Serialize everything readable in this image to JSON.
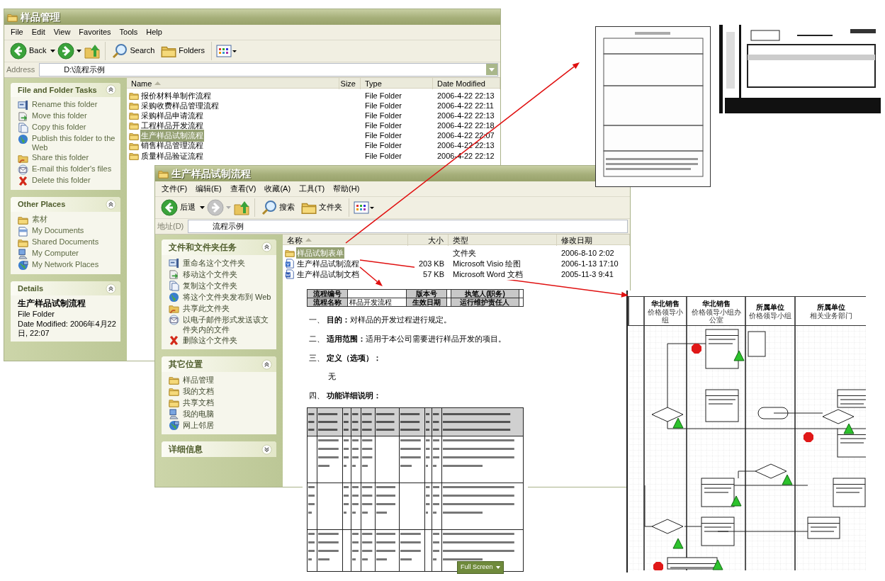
{
  "windows": [
    {
      "title": "样品管理",
      "menu": [
        "File",
        "Edit",
        "View",
        "Favorites",
        "Tools",
        "Help"
      ],
      "back_label": "Back",
      "forward_enabled": true,
      "search_label": "Search",
      "folders_label": "Folders",
      "address_label": "Address",
      "address": "D:\\流程示例",
      "address_dropdown": true,
      "columns": [
        "Name",
        "Size",
        "Type",
        "Date Modified"
      ],
      "rows": [
        {
          "kind": "folder",
          "name": "报价材料单制作流程",
          "type": "File Folder",
          "date": "2006-4-22 22:13",
          "selected": false
        },
        {
          "kind": "folder",
          "name": "采购收费样品管理流程",
          "type": "File Folder",
          "date": "2006-4-22 22:11",
          "selected": false
        },
        {
          "kind": "folder",
          "name": "采购样品申请流程",
          "type": "File Folder",
          "date": "2006-4-22 22:13",
          "selected": false
        },
        {
          "kind": "folder",
          "name": "工程样品开发流程",
          "type": "File Folder",
          "date": "2006-4-22 22:18",
          "selected": false
        },
        {
          "kind": "folder",
          "name": "生产样品试制流程",
          "type": "File Folder",
          "date": "2006-4-22 22:07",
          "selected": true
        },
        {
          "kind": "folder",
          "name": "销售样品管理流程",
          "type": "File Folder",
          "date": "2006-4-22 22:13",
          "selected": false
        },
        {
          "kind": "folder",
          "name": "质量样品验证流程",
          "type": "File Folder",
          "date": "2006-4-22 22:12",
          "selected": false
        }
      ],
      "panels": [
        {
          "kind": "tasks",
          "title": "File and Folder Tasks",
          "expanded": true,
          "items": [
            {
              "kind": "rename",
              "label": "Rename this folder"
            },
            {
              "kind": "move",
              "label": "Move this folder"
            },
            {
              "kind": "copy",
              "label": "Copy this folder"
            },
            {
              "kind": "publish",
              "label": "Publish this folder to the Web"
            },
            {
              "kind": "share",
              "label": "Share this folder"
            },
            {
              "kind": "email",
              "label": "E-mail this folder's files"
            },
            {
              "kind": "delete",
              "label": "Delete this folder"
            }
          ]
        },
        {
          "kind": "tasks",
          "title": "Other Places",
          "expanded": true,
          "items": [
            {
              "kind": "folder",
              "label": "素材"
            },
            {
              "kind": "documents",
              "label": "My Documents"
            },
            {
              "kind": "folder",
              "label": "Shared Documents"
            },
            {
              "kind": "computer",
              "label": "My Computer"
            },
            {
              "kind": "network",
              "label": "My Network Places"
            }
          ]
        },
        {
          "kind": "details",
          "title": "Details",
          "expanded": true,
          "name": "生产样品试制流程",
          "type": "File Folder",
          "modified": "Date Modified: 2006年4月22日, 22:07"
        }
      ]
    },
    {
      "title": "生产样品试制流程",
      "menu": [
        "文件(F)",
        "编辑(E)",
        "查看(V)",
        "收藏(A)",
        "工具(T)",
        "帮助(H)"
      ],
      "back_label": "后退",
      "forward_enabled": false,
      "search_label": "搜索",
      "folders_label": "文件夹",
      "address_label": "地址(D)",
      "address": "流程示例",
      "address_dropdown": false,
      "columns": [
        "名称",
        "大小",
        "类型",
        "修改日期"
      ],
      "rows": [
        {
          "kind": "folder",
          "name": "样品试制表单",
          "type": "文件夹",
          "date": "2006-8-10 2:02",
          "selected": true
        },
        {
          "kind": "visio",
          "name": "生产样品试制流程",
          "size": "203 KB",
          "type": "Microsoft Visio 绘图",
          "date": "2006-1-13 17:10",
          "selected": false
        },
        {
          "kind": "word",
          "name": "生产样品试制文档",
          "size": "57 KB",
          "type": "Microsoft Word 文档",
          "date": "2005-11-3 9:41",
          "selected": false
        }
      ],
      "panels": [
        {
          "kind": "tasks",
          "title": "文件和文件夹任务",
          "expanded": true,
          "items": [
            {
              "kind": "rename",
              "label": "重命名这个文件夹"
            },
            {
              "kind": "move",
              "label": "移动这个文件夹"
            },
            {
              "kind": "copy",
              "label": "复制这个文件夹"
            },
            {
              "kind": "publish",
              "label": "将这个文件夹发布到 Web"
            },
            {
              "kind": "share",
              "label": "共享此文件夹"
            },
            {
              "kind": "email",
              "label": "以电子邮件形式发送该文件夹内的文件"
            },
            {
              "kind": "delete",
              "label": "删除这个文件夹"
            }
          ]
        },
        {
          "kind": "tasks",
          "title": "其它位置",
          "expanded": true,
          "items": [
            {
              "kind": "folder",
              "label": "样品管理"
            },
            {
              "kind": "folder",
              "label": "我的文档"
            },
            {
              "kind": "folder",
              "label": "共享文档"
            },
            {
              "kind": "computer",
              "label": "我的电脑"
            },
            {
              "kind": "network",
              "label": "网上邻居"
            }
          ]
        },
        {
          "kind": "details",
          "title": "详细信息",
          "expanded": false
        }
      ]
    }
  ],
  "document": {
    "header_table": [
      [
        {
          "kind": "label",
          "text": "流程编号"
        },
        {
          "kind": "value"
        },
        {
          "kind": "label",
          "text": "版本号"
        },
        {
          "kind": "value"
        },
        {
          "kind": "label",
          "text": "执笔人(职务)"
        },
        {
          "kind": "value"
        }
      ],
      [
        {
          "kind": "label",
          "text": "流程名称"
        },
        {
          "kind": "value",
          "text": "样品开发流程"
        },
        {
          "kind": "label",
          "text": "生效日期"
        },
        {
          "kind": "value"
        },
        {
          "kind": "label",
          "text": "运行维护责任人"
        },
        {
          "kind": "value"
        }
      ]
    ],
    "sections": [
      {
        "kind": "heading",
        "text": "一、 **目的：**对样品的开发过程进行规定。"
      },
      {
        "kind": "heading",
        "text": "二、 **适用范围：**适用于本公司需要进行样品开发的项目。"
      },
      {
        "kind": "heading",
        "text": "三、 **定义（选项）：**"
      },
      {
        "kind": "body",
        "text": "无"
      },
      {
        "kind": "heading",
        "text": "四、 **功能详细说明：**"
      }
    ],
    "fullscreen_button": "Full Screen"
  },
  "flowchart": {
    "lanes": [
      {
        "title": "华北销售",
        "subtitle": "价格领导小组"
      },
      {
        "title": "华北销售",
        "subtitle": "价格领导小组办公室"
      },
      {
        "title": "所属单位",
        "subtitle": "价格领导小组"
      },
      {
        "title": "所属单位",
        "subtitle": "相关业务部门"
      }
    ]
  }
}
